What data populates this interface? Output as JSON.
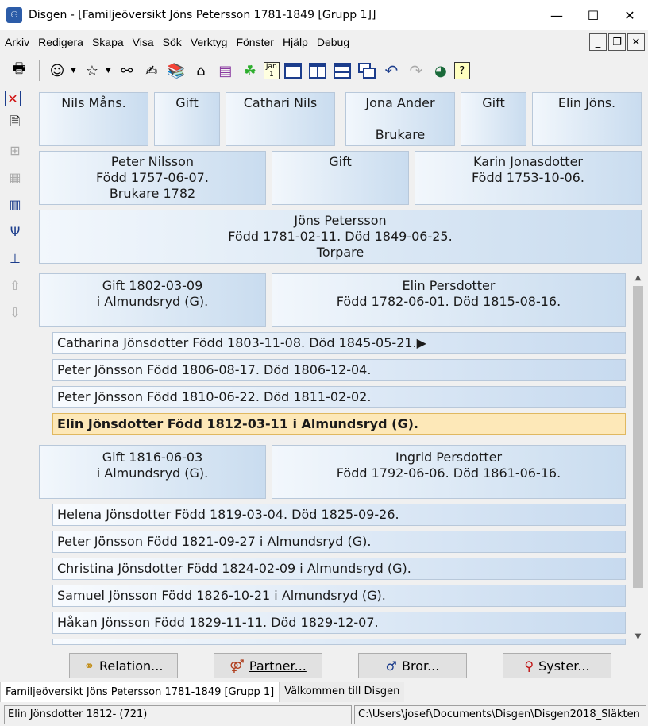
{
  "window": {
    "app_icon": "disgen-app-icon",
    "title": "Disgen - [Familjeöversikt Jöns Petersson 1781-1849 [Grupp 1]]"
  },
  "menu": [
    "Arkiv",
    "Redigera",
    "Skapa",
    "Visa",
    "Sök",
    "Verktyg",
    "Fönster",
    "Hjälp",
    "Debug"
  ],
  "toolbar_icons": [
    "print-icon",
    "person-face-icon",
    "person-star-icon",
    "binoculars-icon",
    "hand-writing-icon",
    "books-icon",
    "home-icon",
    "files-icon",
    "map-green-icon",
    "calendar-jan1-icon",
    "window-single-icon",
    "window-split-vertical-icon",
    "window-split-horizontal-icon",
    "window-cascade-icon",
    "undo-icon",
    "redo-icon",
    "globe-icon",
    "help-icon"
  ],
  "calendar_label": "Jan\n1",
  "grandparents": [
    {
      "text": "Nils Måns."
    },
    {
      "text": "Gift"
    },
    {
      "text": "Cathari Nils"
    },
    {
      "text": "Jona Ander\n\nBrukare"
    },
    {
      "text": "Gift"
    },
    {
      "text": "Elin Jöns."
    }
  ],
  "parents": [
    {
      "text": "Peter Nilsson\nFödd 1757-06-07.\nBrukare 1782"
    },
    {
      "text": "Gift"
    },
    {
      "text": "Karin Jonasdotter\nFödd 1753-10-06."
    }
  ],
  "main_person": "Jöns Petersson\nFödd 1781-02-11. Död 1849-06-25.\nTorpare",
  "marriage1": {
    "gift": "Gift 1802-03-09\ni  Almundsryd (G).",
    "spouse": "Elin Persdotter\nFödd 1782-06-01. Död 1815-08-16."
  },
  "children1": [
    "Catharina Jönsdotter Född 1803-11-08. Död 1845-05-21.▶",
    "Peter Jönsson Född 1806-08-17. Död 1806-12-04.",
    "Peter Jönsson Född 1810-06-22. Död 1811-02-02.",
    "Elin Jönsdotter Född 1812-03-11 i Almundsryd (G)."
  ],
  "marriage2": {
    "gift": "Gift 1816-06-03\ni  Almundsryd (G).",
    "spouse": "Ingrid Persdotter\nFödd 1792-06-06. Död 1861-06-16."
  },
  "children2": [
    "Helena Jönsdotter Född 1819-03-04. Död 1825-09-26.",
    "Peter Jönsson Född 1821-09-27 i Almundsryd (G).",
    "Christina Jönsdotter Född 1824-02-09 i Almundsryd (G).",
    "Samuel Jönsson Född 1826-10-21 i Almundsryd (G).",
    "Håkan Jönsson Född 1829-11-11. Död 1829-12-07."
  ],
  "buttons": {
    "relation": "Relation...",
    "partner": "Partner...",
    "bror": "Bror...",
    "syster": "Syster..."
  },
  "tabs": [
    "Familjeöversikt Jöns Petersson 1781-1849 [Grupp 1]",
    "Välkommen till Disgen"
  ],
  "status": {
    "person": "Elin Jönsdotter 1812- (721)",
    "path": "C:\\Users\\josef\\Documents\\Disgen\\Disgen2018_Släkten"
  },
  "colors": {
    "tile_gradient_start": "#f2f7fc",
    "tile_gradient_end": "#c9dcef",
    "selected_row": "#fde8b8"
  }
}
